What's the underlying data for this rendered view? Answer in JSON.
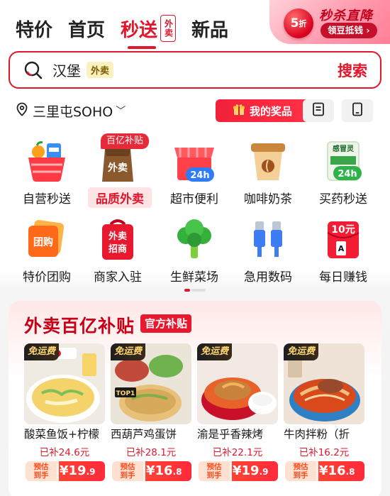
{
  "tabs": [
    {
      "label": "特价"
    },
    {
      "label": "首页"
    },
    {
      "label": "秒送",
      "tag": "外卖"
    },
    {
      "label": "新品"
    }
  ],
  "promo": {
    "title": "秒杀直降",
    "discount": "5",
    "discount_unit": "折",
    "pill": "领豆抵钱 ›"
  },
  "search": {
    "value": "汉堡",
    "chip": "外卖",
    "button": "搜索"
  },
  "location": {
    "text": "三里屯SOHO",
    "chevron": "﹀"
  },
  "actions": {
    "prize": "我的奖品"
  },
  "categories": [
    {
      "label": "自营秒送",
      "icon": "basket-icon"
    },
    {
      "label": "品质外卖",
      "icon": "takeout-bag-icon",
      "badge": "百亿补贴",
      "highlight": true,
      "icon_text": "外卖"
    },
    {
      "label": "超市便利",
      "icon": "store-icon",
      "icon_text": "24h"
    },
    {
      "label": "咖啡奶茶",
      "icon": "coffee-cup-icon"
    },
    {
      "label": "买药秒送",
      "icon": "medicine-icon",
      "icon_text": "24h",
      "icon_top": "感冒灵"
    },
    {
      "label": "特价团购",
      "icon": "group-ticket-icon",
      "icon_text": "团购"
    },
    {
      "label": "商家入驻",
      "icon": "merchant-bag-icon",
      "icon_text": "外卖招商"
    },
    {
      "label": "生鲜菜场",
      "icon": "broccoli-icon"
    },
    {
      "label": "急用数码",
      "icon": "usb-cable-icon"
    },
    {
      "label": "每日赚钱",
      "icon": "red-envelope-icon",
      "icon_text": "10元"
    }
  ],
  "subsidy": {
    "title": "外卖百亿补贴",
    "tag": "官方补贴",
    "dishes": [
      {
        "tag": "免运费",
        "name": "酸菜鱼饭+柠檬",
        "subsidy": "已补24.6元",
        "est": "预估到手",
        "price": "¥19",
        "price_dec": ".9"
      },
      {
        "tag": "免运费",
        "name": "西葫芦鸡蛋饼",
        "subsidy": "已补28.1元",
        "est": "预估到手",
        "price": "¥16",
        "price_dec": ".8"
      },
      {
        "tag": "免运费",
        "name": "渝是乎香辣烤",
        "subsidy": "已补22.1元",
        "est": "预估到手",
        "price": "¥19",
        "price_dec": ".9"
      },
      {
        "tag": "免运费",
        "name": "牛肉拌粉（折",
        "subsidy": "已补16.2元",
        "est": "预估到手",
        "price": "¥16",
        "price_dec": ".8"
      }
    ]
  },
  "colors": {
    "accent": "#e0182d",
    "chip_bg": "#fbf1bf"
  }
}
